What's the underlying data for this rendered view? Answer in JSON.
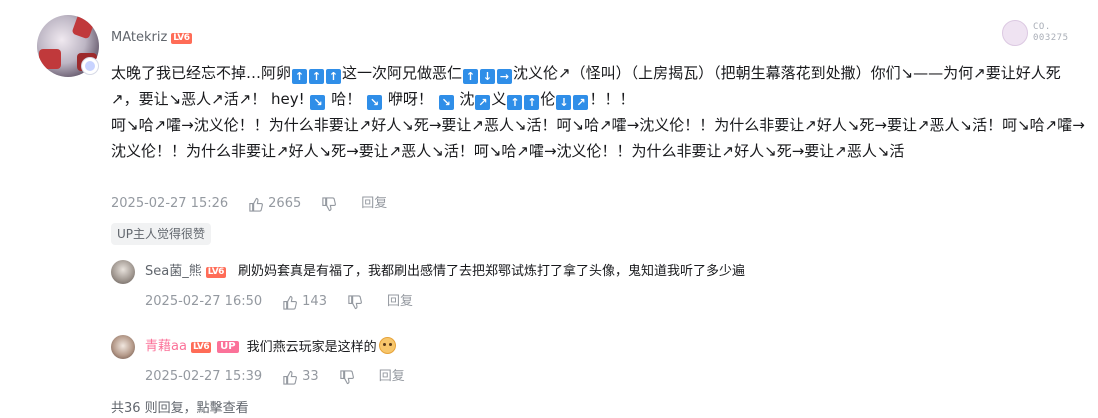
{
  "main_comment": {
    "username": "MAtekriz",
    "level": "LV6",
    "medal_text_line1": "CO.",
    "medal_text_line2": "003275",
    "text_part1": "太晚了我已经忘不掉…阿卵",
    "text_part2": "这一次阿兄做恶仁",
    "text_part3": "沈义伦↗（怪叫）（上房揭瓦）（把朝生幕落花到处撒）你们↘——为何↗要让好人死↗，要让↘恶人↗活↗！ hey!",
    "text_part4": "哈！",
    "text_part5": "咿呀！",
    "text_part6": "沈",
    "text_part7": "义",
    "text_part8": "伦",
    "text_part9": "！！！",
    "text_line3": "呵↘哈↗嚯→沈义伦！！为什么非要让↗好人↘死→要让↗恶人↘活！呵↘哈↗嚯→沈义伦！！为什么非要让↗好人↘死→要让↗恶人↘活！呵↘哈↗嚯→沈义伦！！为什么非要让↗好人↘死→要让↗恶人↘活！呵↘哈↗嚯→沈义伦！！为什么非要让↗好人↘死→要让↗恶人↘活",
    "date": "2025-02-27 15:26",
    "likes": "2665",
    "reply_label": "回复",
    "tag": "UP主人觉得很赞"
  },
  "replies": [
    {
      "username": "Sea菌_熊",
      "level": "LV6",
      "text": "刷奶妈套真是有福了，我都刷出感情了去把郑鄂试炼打了拿了头像，鬼知道我听了多少遍",
      "date": "2025-02-27 16:50",
      "likes": "143",
      "reply_label": "回复"
    },
    {
      "username": "青藉aa",
      "level": "LV6",
      "up_badge": "UP",
      "text": "我们燕云玩家是这样的",
      "date": "2025-02-27 15:39",
      "likes": "33",
      "reply_label": "回复"
    }
  ],
  "footer": "共36 则回复，點擊查看",
  "colors": {
    "arrow_badge": "#2f8ee8",
    "level_badge": "#ff6c57",
    "up_badge": "#fb7299",
    "meta_gray": "#9499a0"
  }
}
